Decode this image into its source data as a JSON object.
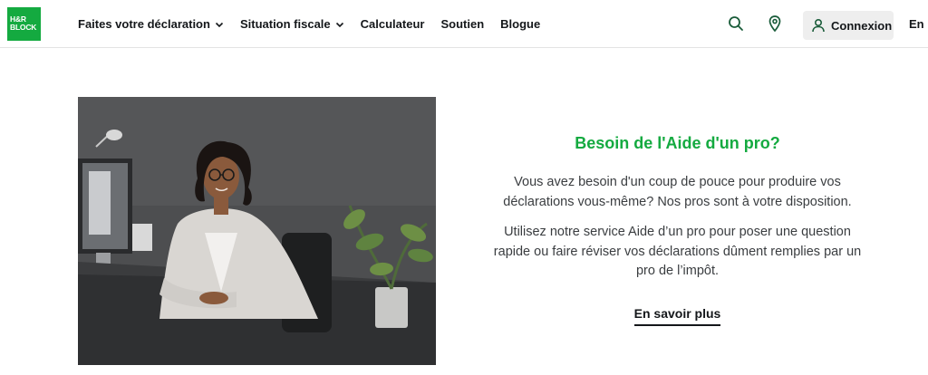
{
  "logo": {
    "line1": "H&R",
    "line2": "BLOCK",
    "brand_color": "#14aa40"
  },
  "nav": {
    "items": [
      {
        "label": "Faites votre déclaration",
        "has_dropdown": true
      },
      {
        "label": "Situation fiscale",
        "has_dropdown": true
      },
      {
        "label": "Calculateur",
        "has_dropdown": false
      },
      {
        "label": "Soutien",
        "has_dropdown": false
      },
      {
        "label": "Blogue",
        "has_dropdown": false
      }
    ]
  },
  "header_actions": {
    "search_icon": "search-icon",
    "location_icon": "map-pin-icon",
    "login_label": "Connexion",
    "login_icon": "user-icon",
    "language": "En"
  },
  "hero": {
    "image_alt": "Professional woman seated at desk in office",
    "title": "Besoin de l'Aide d'un pro?",
    "paragraph1": "Vous avez besoin d'un coup de pouce pour produire vos déclarations vous-même? Nos pros sont à votre disposition.",
    "paragraph2": "Utilisez notre service Aide d’un pro pour poser une question rapide ou faire réviser vos déclarations dûment remplies par un pro de l’impôt.",
    "cta_label": "En savoir plus"
  },
  "colors": {
    "accent": "#14aa40",
    "text": "#14171a",
    "button_bg": "#eeeeee"
  }
}
